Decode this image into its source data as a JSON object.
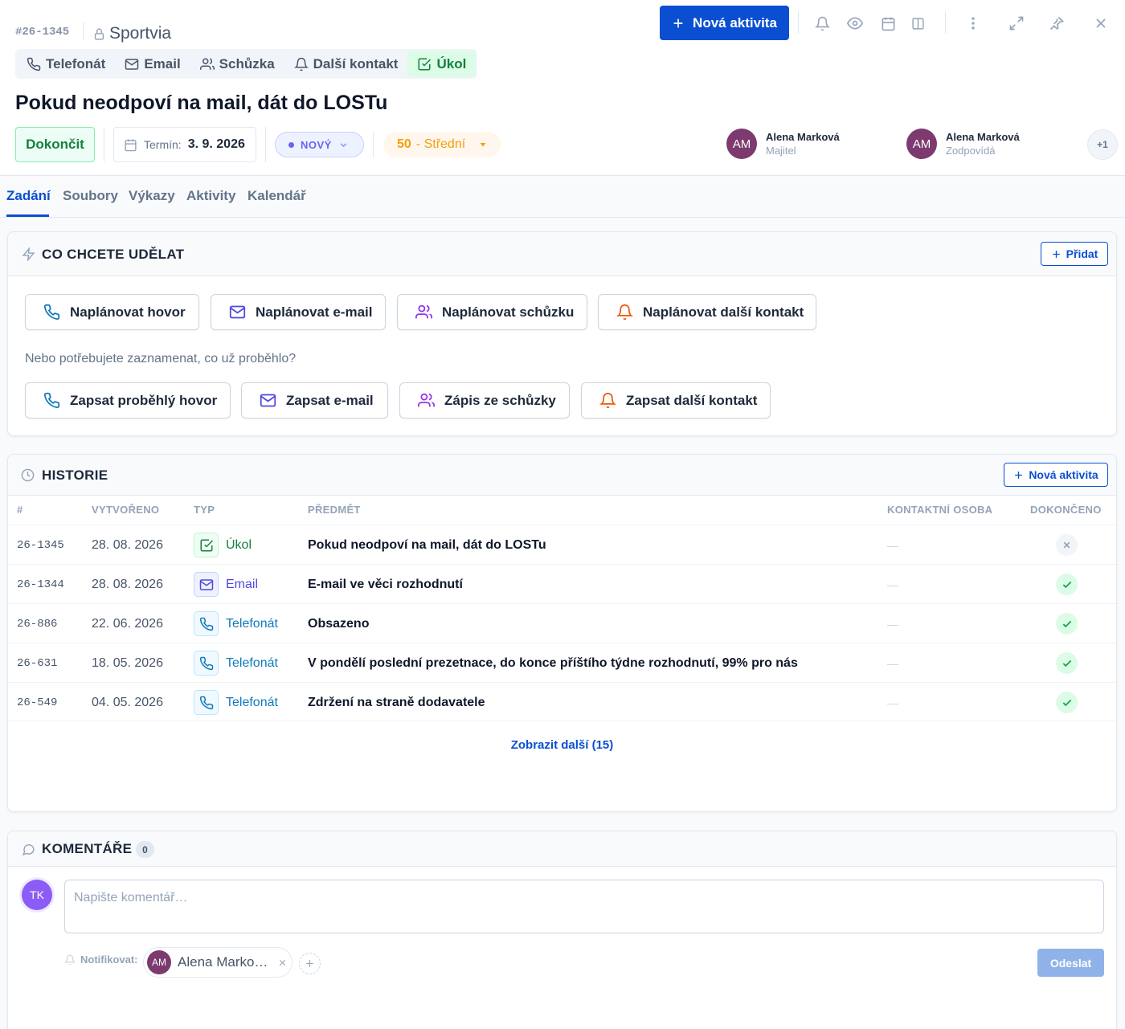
{
  "header": {
    "task_id": "#26-1345",
    "company": "Sportvia",
    "type_tabs": [
      {
        "label": "Telefonát",
        "icon": "phone-icon"
      },
      {
        "label": "Email",
        "icon": "mail-icon"
      },
      {
        "label": "Schůzka",
        "icon": "users-icon"
      },
      {
        "label": "Další kontakt",
        "icon": "bell-icon"
      },
      {
        "label": "Úkol",
        "icon": "check-square-icon",
        "active": true
      }
    ],
    "new_activity_label": "Nová aktivita",
    "title": "Pokud neodpoví na mail, dát do LOSTu",
    "complete_label": "Dokončit",
    "deadline_label": "Termín:",
    "deadline_value": "3. 9. 2026",
    "status": "NOVÝ",
    "priority_number": "50",
    "priority_label": "- Střední",
    "people": [
      {
        "initials": "AM",
        "name": "Alena Marková",
        "role": "Majitel"
      },
      {
        "initials": "AM",
        "name": "Alena Marková",
        "role": "Zodpovídá"
      }
    ],
    "more_people": "+1"
  },
  "tabs": [
    "Zadání",
    "Soubory",
    "Výkazy",
    "Aktivity",
    "Kalendář"
  ],
  "actions": {
    "title": "CO CHCETE UDĚLAT",
    "add_label": "Přidat",
    "plan_buttons": [
      "Naplánovat hovor",
      "Naplánovat e-mail",
      "Naplánovat schůzku",
      "Naplánovat další kontakt"
    ],
    "hint": "Nebo potřebujete zaznamenat, co už proběhlo?",
    "log_buttons": [
      "Zapsat proběhlý hovor",
      "Zapsat e-mail",
      "Zápis ze schůzky",
      "Zapsat další kontakt"
    ]
  },
  "history": {
    "title": "HISTORIE",
    "new_activity_label": "Nová aktivita",
    "columns": [
      "#",
      "VYTVOŘENO",
      "TYP",
      "PŘEDMĚT",
      "KONTAKTNÍ OSOBA",
      "DOKONČENO"
    ],
    "rows": [
      {
        "id": "26-1345",
        "date": "28. 08. 2026",
        "type": "Úkol",
        "subject": "Pokud neodpoví na mail, dát do LOSTu",
        "contact": "—",
        "done": false
      },
      {
        "id": "26-1344",
        "date": "28. 08. 2026",
        "type": "Email",
        "subject": "E-mail ve věci rozhodnutí",
        "contact": "—",
        "done": true
      },
      {
        "id": "26-886",
        "date": "22. 06. 2026",
        "type": "Telefonát",
        "subject": "Obsazeno",
        "contact": "—",
        "done": true
      },
      {
        "id": "26-631",
        "date": "18. 05. 2026",
        "type": "Telefonát",
        "subject": "V pondělí poslední prezetnace, do konce příštího týdne rozhodnutí, 99% pro nás",
        "contact": "—",
        "done": true
      },
      {
        "id": "26-549",
        "date": "04. 05. 2026",
        "type": "Telefonát",
        "subject": "Zdržení na straně dodavatele",
        "contact": "—",
        "done": true
      }
    ],
    "more_label": "Zobrazit další (15)"
  },
  "comments": {
    "title": "KOMENTÁŘE",
    "count": "0",
    "user_initials": "TK",
    "placeholder": "Napište komentář…",
    "notify_label": "Notifikovat:",
    "notify_chip_initials": "AM",
    "notify_chip_name": "Alena Marko…",
    "send_label": "Odeslat"
  },
  "colors": {
    "primary": "#0a4fd1",
    "success": "#15803d",
    "status": "#6366f1",
    "priority": "#f59e0b",
    "avatar": "#7c3a6e"
  }
}
